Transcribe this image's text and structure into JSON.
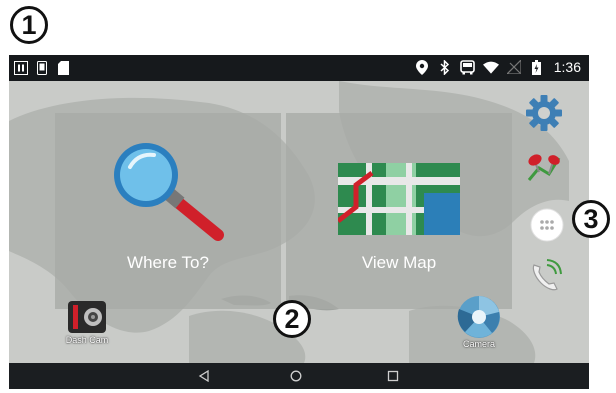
{
  "callouts": [
    "1",
    "2",
    "3"
  ],
  "status_bar": {
    "time": "1:36",
    "left_icons": [
      "pause-icon",
      "phone-icon",
      "sd-card-icon"
    ],
    "right_icons": [
      "location-pin-icon",
      "bluetooth-icon",
      "bus-icon",
      "wifi-icon",
      "no-signal-icon",
      "battery-icon"
    ]
  },
  "home": {
    "tiles": [
      {
        "label": "Where To?",
        "icon": "magnifier-icon"
      },
      {
        "label": "View Map",
        "icon": "map-icon"
      }
    ],
    "apps": [
      {
        "label": "Dash Cam",
        "icon": "dash-cam-icon"
      },
      {
        "label": "Camera",
        "icon": "camera-aperture-icon"
      }
    ],
    "side_buttons": [
      "settings-gear-icon",
      "pins-icon",
      "app-drawer-icon",
      "phone-call-icon"
    ]
  },
  "nav_bar": [
    "back-icon",
    "home-icon",
    "recents-icon"
  ],
  "colors": {
    "tile": "#a8aaa7",
    "map_background": "#c9cbc8",
    "status_bar": "#16191c",
    "nav_bar": "#1b1e21"
  }
}
